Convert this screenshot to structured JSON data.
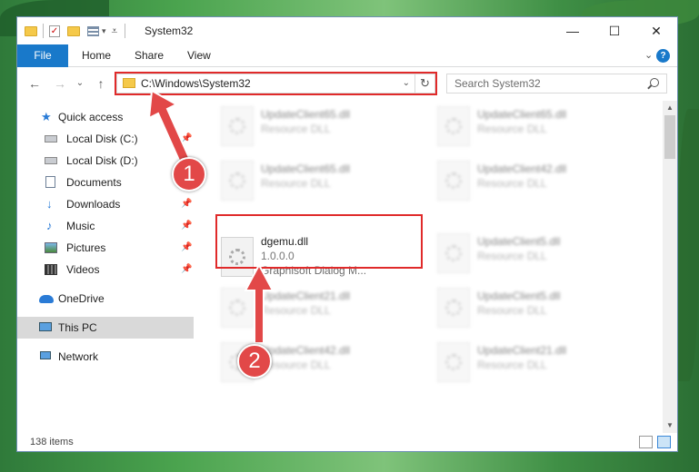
{
  "window": {
    "title": "System32",
    "controls": {
      "minimize": "—",
      "maximize": "☐",
      "close": "✕"
    }
  },
  "ribbon": {
    "tabs": [
      "File",
      "Home",
      "Share",
      "View"
    ],
    "collapse": "⌄",
    "help": "?"
  },
  "nav": {
    "back": "←",
    "forward": "→",
    "recent": "⌄",
    "up": "↑",
    "address": "C:\\Windows\\System32",
    "address_drop": "⌄",
    "refresh": "↻",
    "search_placeholder": "Search System32"
  },
  "sidebar": {
    "items": [
      {
        "label": "Quick access",
        "icon": "star-icon",
        "pinned": false
      },
      {
        "label": "Local Disk (C:)",
        "icon": "disk-icon",
        "pinned": true
      },
      {
        "label": "Local Disk (D:)",
        "icon": "disk-icon",
        "pinned": false
      },
      {
        "label": "Documents",
        "icon": "documents-icon",
        "pinned": true
      },
      {
        "label": "Downloads",
        "icon": "download-icon",
        "pinned": true
      },
      {
        "label": "Music",
        "icon": "music-icon",
        "pinned": true
      },
      {
        "label": "Pictures",
        "icon": "pictures-icon",
        "pinned": true
      },
      {
        "label": "Videos",
        "icon": "videos-icon",
        "pinned": true
      },
      {
        "label": "OneDrive",
        "icon": "onedrive-icon",
        "pinned": false
      },
      {
        "label": "This PC",
        "icon": "computer-icon",
        "pinned": false,
        "selected": true
      },
      {
        "label": "Network",
        "icon": "network-icon",
        "pinned": false
      }
    ],
    "pin_glyph": "📌"
  },
  "files": {
    "left": [
      {
        "name": "UpdateClient65.dll",
        "type": "Resource DLL"
      },
      {
        "name": "UpdateClient65.dll",
        "type": "Resource DLL"
      },
      {
        "name": "dgemu.dll",
        "type": "1.0.0.0",
        "desc": "Graphisoft Dialog M..."
      },
      {
        "name": "UpdateClient21.dll",
        "type": "Resource DLL"
      },
      {
        "name": "UpdateClient42.dll",
        "type": "Resource DLL"
      }
    ],
    "right": [
      {
        "name": "UpdateClient65.dll",
        "type": "Resource DLL"
      },
      {
        "name": "UpdateClient42.dll",
        "type": "Resource DLL"
      },
      {
        "name": "UpdateClient5.dll",
        "type": "Resource DLL"
      },
      {
        "name": "UpdateClient5.dll",
        "type": "Resource DLL"
      },
      {
        "name": "UpdateClient21.dll",
        "type": "Resource DLL"
      }
    ]
  },
  "status": {
    "item_count": "138 items"
  },
  "annotations": {
    "step1": "1",
    "step2": "2",
    "color": "#e02a2a"
  }
}
